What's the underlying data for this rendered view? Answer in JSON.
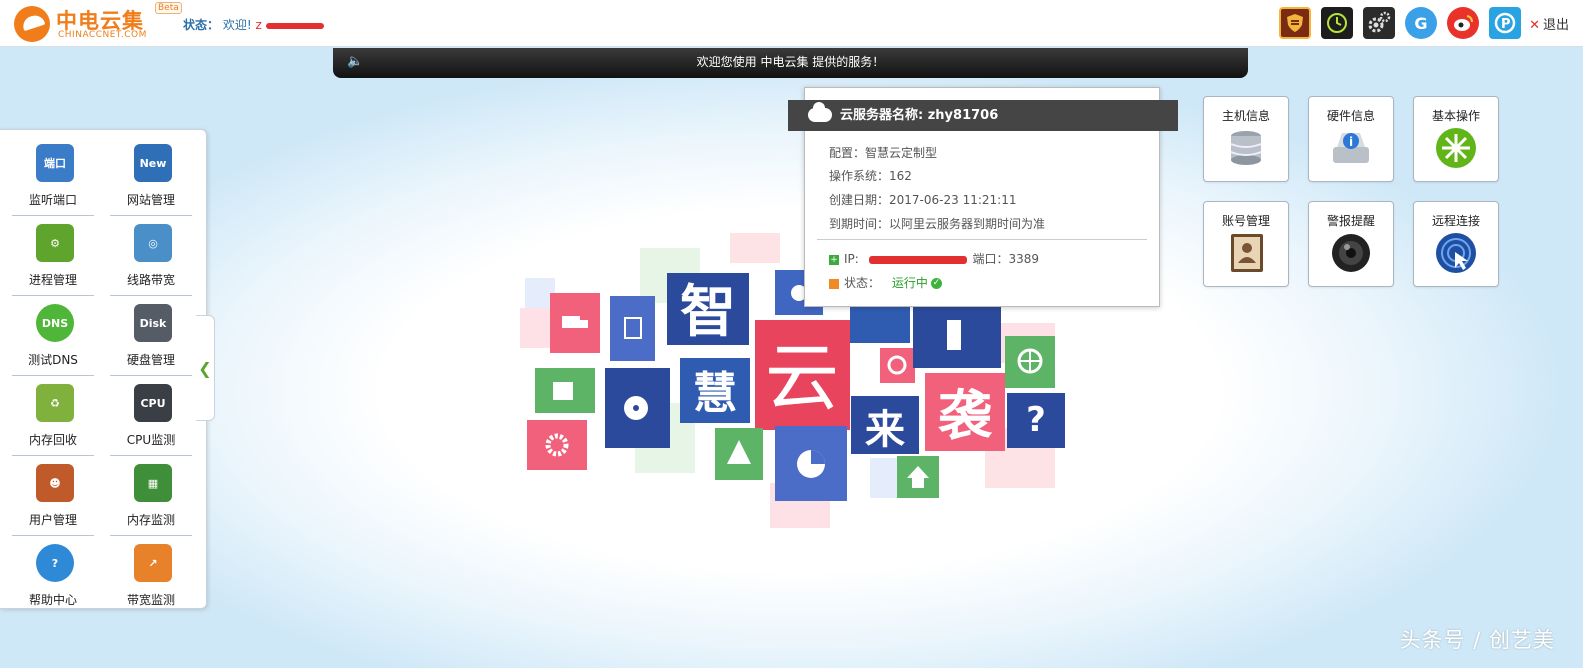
{
  "header": {
    "logo_cn": "中电云集",
    "logo_en": "CHINACCNET.COM",
    "logo_beta": "Beta",
    "status_label": "状态：",
    "status_welcome": "欢迎!",
    "status_user_initial": "z",
    "top_icons": [
      "shield-icon",
      "clock-icon",
      "gear-icon",
      "google-icon",
      "weibo-icon",
      "pay-icon"
    ],
    "logout_label": "退出"
  },
  "notice": {
    "text": "欢迎您使用 中电云集 提供的服务！"
  },
  "sidebar": {
    "items": [
      {
        "label": "监听端口",
        "icon_text": "端口",
        "color": "#3b7cc8"
      },
      {
        "label": "网站管理",
        "icon_text": "New",
        "color": "#2f6fb8"
      },
      {
        "label": "进程管理",
        "icon_text": "⚙",
        "color": "#5fa52d"
      },
      {
        "label": "线路带宽",
        "icon_text": "◎",
        "color": "#4a8fc8"
      },
      {
        "label": "测试DNS",
        "icon_text": "DNS",
        "color": "#4fb63a"
      },
      {
        "label": "硬盘管理",
        "icon_text": "Disk",
        "color": "#555c66"
      },
      {
        "label": "内存回收",
        "icon_text": "♻",
        "color": "#7fb13c"
      },
      {
        "label": "CPU监测",
        "icon_text": "CPU",
        "color": "#3a3f45"
      },
      {
        "label": "用户管理",
        "icon_text": "☻",
        "color": "#c05a2a"
      },
      {
        "label": "内存监测",
        "icon_text": "▦",
        "color": "#3e8e3a"
      },
      {
        "label": "帮助中心",
        "icon_text": "?",
        "color": "#2e8ad6"
      },
      {
        "label": "带宽监测",
        "icon_text": "↗",
        "color": "#e8822a"
      }
    ]
  },
  "server": {
    "title": "云服务器名称: zhy81706",
    "config_label": "配置：",
    "config_value": "智慧云定制型",
    "os_label": "操作系统：",
    "os_value": "162",
    "created_label": "创建日期：",
    "created_value": "2017-06-23 11:21:11",
    "expire_label": "到期时间：",
    "expire_value": "以阿里云服务器到期时间为准",
    "ip_label": "IP:",
    "port_label": "端口：",
    "port_value": "3389",
    "state_label": "状态：",
    "state_value": "运行中"
  },
  "actions": {
    "items": [
      {
        "label": "主机信息"
      },
      {
        "label": "硬件信息"
      },
      {
        "label": "基本操作"
      },
      {
        "label": "账号管理"
      },
      {
        "label": "警报提醒"
      },
      {
        "label": "远程连接"
      }
    ]
  },
  "banner": {
    "chars": [
      "智",
      "慧",
      "云",
      "来",
      "袭"
    ]
  },
  "watermark": "头条号 / 创艺美"
}
